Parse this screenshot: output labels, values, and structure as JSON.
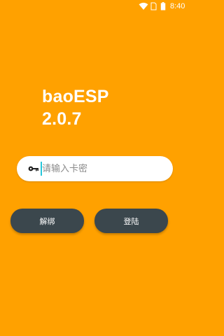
{
  "status_bar": {
    "time": "8:40",
    "icons": [
      "wifi-icon",
      "sim-card-icon",
      "battery-icon"
    ]
  },
  "app": {
    "name": "baoESP",
    "version": "2.0.7"
  },
  "card_input": {
    "placeholder": "请输入卡密",
    "value": "",
    "icon": "key-icon"
  },
  "buttons": {
    "unbind_label": "解绑",
    "login_label": "登陆"
  },
  "colors": {
    "background": "#FFA100",
    "button": "#3B474D",
    "input_bg": "#FFFFFF",
    "caret": "#26C6DA"
  }
}
